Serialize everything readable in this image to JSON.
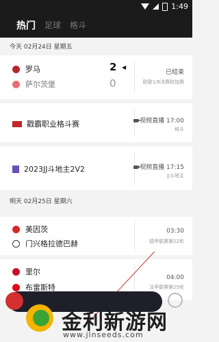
{
  "statusbar": {
    "time": "1:49"
  },
  "tabs": [
    {
      "label": "热门",
      "active": true
    },
    {
      "label": "足球",
      "active": false
    },
    {
      "label": "格斗",
      "active": false
    }
  ],
  "sections": [
    {
      "date": "今天 02月24日 星期五",
      "match": {
        "home": "罗马",
        "away": "萨尔茨堡",
        "home_score": "2",
        "away_score": "0",
        "status": "已结束",
        "subtitle": "欧联1/8决赛附加赛"
      },
      "events": [
        {
          "title": "戳霸职业格斗赛",
          "broadcast": "视频直播 17:00",
          "category": "格斗"
        },
        {
          "title": "2023JJ斗地主2V2",
          "broadcast": "视频直播 17:15",
          "category": "JJ斗地主"
        }
      ]
    },
    {
      "date": "明天 02月25日 星期六",
      "matches": [
        {
          "home": "美因茨",
          "away": "门兴格拉德巴赫",
          "time": "03:30",
          "league": "德甲联赛第22轮"
        },
        {
          "home": "里尔",
          "away": "布雷斯特",
          "time": "04:00",
          "league": "法甲联赛第25轮"
        }
      ]
    }
  ],
  "watermark": {
    "title": "金利新游网",
    "url": "www.jlnseeds.com"
  },
  "colors": {
    "accent": "#d43030",
    "dark": "#1b1b1b"
  },
  "icons": [
    "wifi-icon",
    "signal-icon",
    "battery-icon",
    "video-icon"
  ]
}
